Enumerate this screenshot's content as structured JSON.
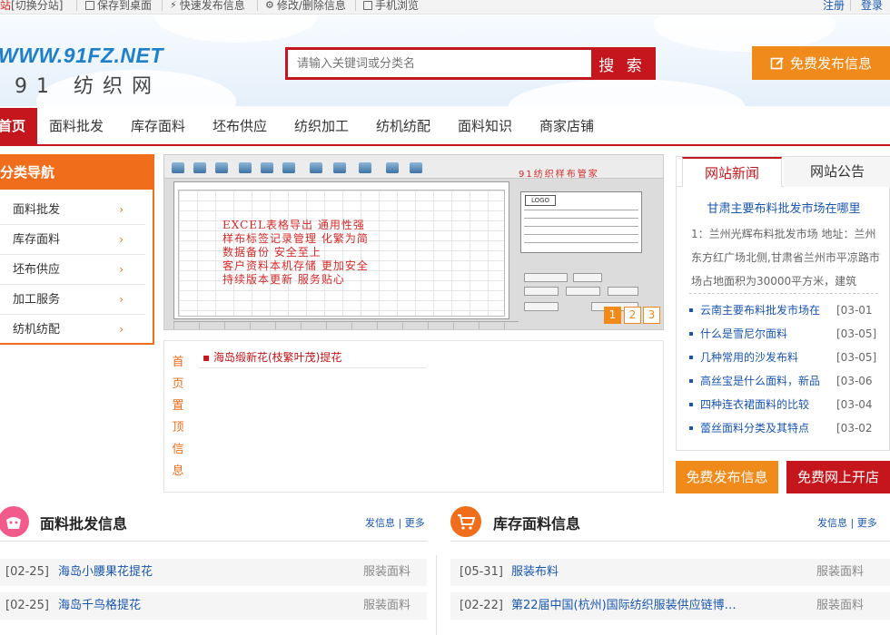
{
  "topbar": {
    "city": "站",
    "switch_label": "[切换分站]",
    "save_desktop": "保存到桌面",
    "quick_publish": "快速发布信息",
    "edit_delete": "修改/删除信息",
    "mobile": "手机浏览",
    "register": "注册",
    "login": "登录"
  },
  "header": {
    "logo_en": "WWW.91FZ.NET",
    "logo_cn": "91 纺织网",
    "search_placeholder": "请输入关键词或分类名",
    "search_button": "搜 索",
    "publish_button": "免费发布信息"
  },
  "nav": {
    "items": [
      "首页",
      "面料批发",
      "库存面料",
      "坯布供应",
      "纺织加工",
      "纺机纺配",
      "面料知识",
      "商家店铺"
    ]
  },
  "sidebar": {
    "title": "分类导航",
    "items": [
      "面料批发",
      "库存面料",
      "坯布供应",
      "加工服务",
      "纺机纺配"
    ]
  },
  "banner": {
    "title": "91纺织样布管家",
    "lines": [
      "EXCEL表格导出 通用性强",
      "样布标签记录管理 化繁为简",
      "数据备份 安全至上",
      "客户资料本机存储 更加安全",
      "持续版本更新 服务贴心"
    ],
    "card_logo": "LOGO",
    "pages": [
      "1",
      "2",
      "3"
    ]
  },
  "pinned": {
    "side_label": [
      "首",
      "页",
      "置",
      "顶",
      "信",
      "息"
    ],
    "items": [
      "海岛缎新花(枝繁叶茂)提花"
    ]
  },
  "news": {
    "tab_news": "网站新闻",
    "tab_notice": "网站公告",
    "headline": "甘肃主要布料批发市场在哪里",
    "summary": "1：兰州光辉布料批发市场 地址：兰州东方红广场北侧,甘肃省兰州市平凉路市场占地面积为30000平方米，建筑",
    "items": [
      {
        "title": "云南主要布料批发市场在",
        "date": "[03-01"
      },
      {
        "title": "什么是雪尼尔面料",
        "date": "[03-05]"
      },
      {
        "title": "几种常用的沙发布料",
        "date": "[03-05]"
      },
      {
        "title": "高丝宝是什么面料，新品",
        "date": "[03-06"
      },
      {
        "title": "四种连衣裙面料的比较",
        "date": "[03-04"
      },
      {
        "title": "蕾丝面料分类及其特点",
        "date": "[03-02"
      }
    ]
  },
  "actions": {
    "free_publish": "免费发布信息",
    "free_shop": "免费网上开店"
  },
  "sections": {
    "left": {
      "title": "面料批发信息",
      "publish": "发信息",
      "more": "更多",
      "rows": [
        {
          "date": "[02-25]",
          "title": "海岛小腰果花提花",
          "cat": "服装面料"
        },
        {
          "date": "[02-25]",
          "title": "海岛千鸟格提花",
          "cat": "服装面料"
        }
      ]
    },
    "right": {
      "title": "库存面料信息",
      "publish": "发信息",
      "more": "更多",
      "rows": [
        {
          "date": "[05-31]",
          "title": "服装布料",
          "cat": "服装面料"
        },
        {
          "date": "[02-22]",
          "title": "第22届中国(杭州)国际纺织服装供应链博…",
          "cat": "服装面料"
        }
      ]
    }
  },
  "colors": {
    "brand_red": "#c4161c",
    "orange": "#f08a1b",
    "link_blue": "#1a56b0"
  }
}
